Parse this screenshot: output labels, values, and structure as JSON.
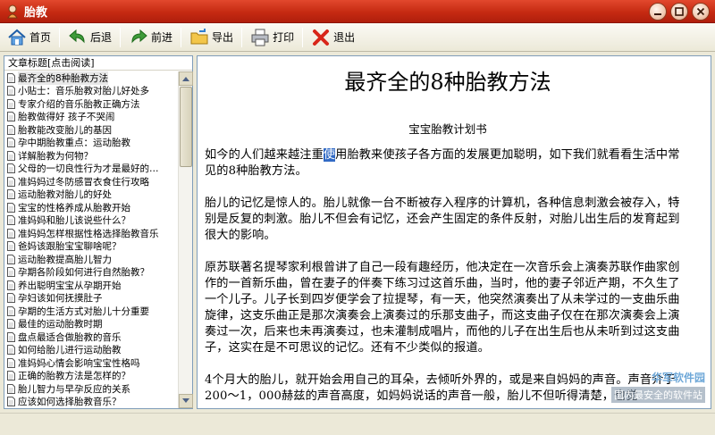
{
  "window": {
    "title": "胎教",
    "colors": {
      "titlebar": "#c52a12",
      "selection": "#316ac5"
    }
  },
  "toolbar": {
    "buttons": [
      {
        "label": "首页",
        "icon": "home-icon"
      },
      {
        "label": "后退",
        "icon": "back-arrow-icon"
      },
      {
        "label": "前进",
        "icon": "forward-arrow-icon"
      },
      {
        "label": "导出",
        "icon": "export-folder-icon"
      },
      {
        "label": "打印",
        "icon": "printer-icon"
      },
      {
        "label": "退出",
        "icon": "exit-x-icon"
      }
    ]
  },
  "sidebar": {
    "header": "文章标题[点击阅读]",
    "items": [
      "最齐全的8种胎教方法",
      "小贴士：音乐胎教对胎儿好处多",
      "专家介绍的音乐胎教正确方法",
      "胎教做得好  孩子不哭闹",
      "胎教能改变胎儿的基因",
      "孕中期胎教重点：运动胎教",
      "详解胎教为何物？",
      "父母的一切良性行为才是最好的…",
      "准妈妈过冬防感冒衣食住行攻略",
      "运动胎教对胎儿的好处",
      "宝宝的性格养成从胎教开始",
      "准妈妈和胎儿该说些什么？",
      "准妈妈怎样根据性格选择胎教音乐",
      "爸妈该跟胎宝宝聊啥呢？",
      "运动胎教提高胎儿智力",
      "孕期各阶段如何进行自然胎教？",
      "养出聪明宝宝从孕期开始",
      "孕妇该如何抚摸肚子",
      "孕期的生活方式对胎儿十分重要",
      "最佳的运动胎教时期",
      "盘点最适合做胎教的音乐",
      "如何给胎儿进行运动胎教",
      "准妈妈心情会影响宝宝性格吗",
      "正确的胎教方法是怎样的？",
      "胎儿智力与早孕反应的关系",
      "应该如何选择胎教音乐？"
    ]
  },
  "article": {
    "title": "最齐全的8种胎教方法",
    "subtitle": "宝宝胎教计划书",
    "p1_before": "如今的人们越来越注重",
    "p1_highlight": "使",
    "p1_after": "用胎教来使孩子各方面的发展更加聪明，如下我们就看看生活中常见的8种胎教方法。",
    "p2": "胎儿的记忆是惊人的。胎儿就像一台不断被存入程序的计算机，各种信息刺激会被存入，特别是反复的刺激。胎儿不但会有记忆，还会产生固定的条件反射，对胎儿出生后的发育起到很大的影响。",
    "p3": "原苏联著名提琴家利根曾讲了自己一段有趣经历，他决定在一次音乐会上演奏苏联作曲家创作的一首新乐曲，曾在妻子的伴奏下练习过这首乐曲，当时，他的妻子邻近产期，不久生了一个儿子。儿子长到四岁便学会了拉提琴，有一天，他突然演奏出了从未学过的一支曲乐曲旋律，这支乐曲正是那次演奏会上演奏过的乐那支曲子，而这支曲子仅在在那次演奏会上演奏过一次，后来也未再演奏过，也未灌制成唱片，而他的儿子在出生后也从未听到过这支曲子，这实在是不可思议的记忆。还有不少类似的报道。",
    "p4": "4个月大的胎儿，就开始会用自己的耳朵，去倾听外界的，或是来自妈妈的声音。声音介于200～1，000赫兹的声音高度，如妈妈说话的声音一般，胎儿不但听得清楚，也觉"
  },
  "watermark": {
    "line1": "华军软件园",
    "line2": "国内最安全的软件站"
  }
}
